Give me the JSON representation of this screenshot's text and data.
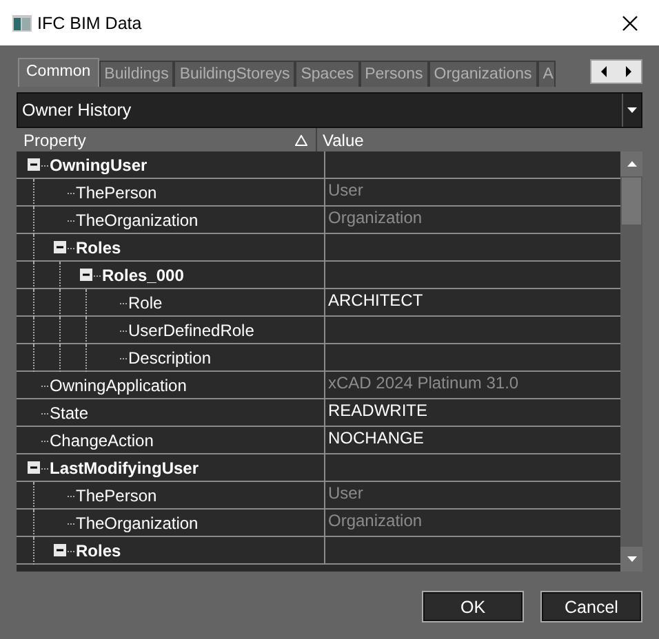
{
  "window": {
    "title": "IFC BIM Data"
  },
  "tabs": [
    {
      "label": "Common",
      "selected": true
    },
    {
      "label": "Buildings",
      "selected": false
    },
    {
      "label": "BuildingStoreys",
      "selected": false
    },
    {
      "label": "Spaces",
      "selected": false
    },
    {
      "label": "Persons",
      "selected": false
    },
    {
      "label": "Organizations",
      "selected": false
    },
    {
      "label": "A",
      "selected": false
    }
  ],
  "category_select": {
    "value": "Owner History"
  },
  "grid": {
    "columns": [
      "Property",
      "Value"
    ],
    "rows": [
      {
        "name": "OwningUser",
        "expanded": true,
        "children": [
          {
            "name": "ThePerson",
            "value": "User",
            "dimmed": true
          },
          {
            "name": "TheOrganization",
            "value": "Organization",
            "dimmed": true
          },
          {
            "name": "Roles",
            "expanded": true,
            "children": [
              {
                "name": "Roles_000",
                "expanded": true,
                "children": [
                  {
                    "name": "Role",
                    "value": "ARCHITECT",
                    "dimmed": false
                  },
                  {
                    "name": "UserDefinedRole"
                  },
                  {
                    "name": "Description"
                  }
                ]
              }
            ]
          }
        ]
      },
      {
        "name": "OwningApplication",
        "value": "xCAD 2024 Platinum 31.0",
        "dimmed": true
      },
      {
        "name": "State",
        "value": "READWRITE",
        "dimmed": false
      },
      {
        "name": "ChangeAction",
        "value": "NOCHANGE",
        "dimmed": false
      },
      {
        "name": "LastModifyingUser",
        "expanded": true,
        "children": [
          {
            "name": "ThePerson",
            "value": "User",
            "dimmed": true
          },
          {
            "name": "TheOrganization",
            "value": "Organization",
            "dimmed": true
          },
          {
            "name": "Roles",
            "expanded": true
          }
        ]
      }
    ]
  },
  "buttons": [
    "OK",
    "Cancel"
  ]
}
